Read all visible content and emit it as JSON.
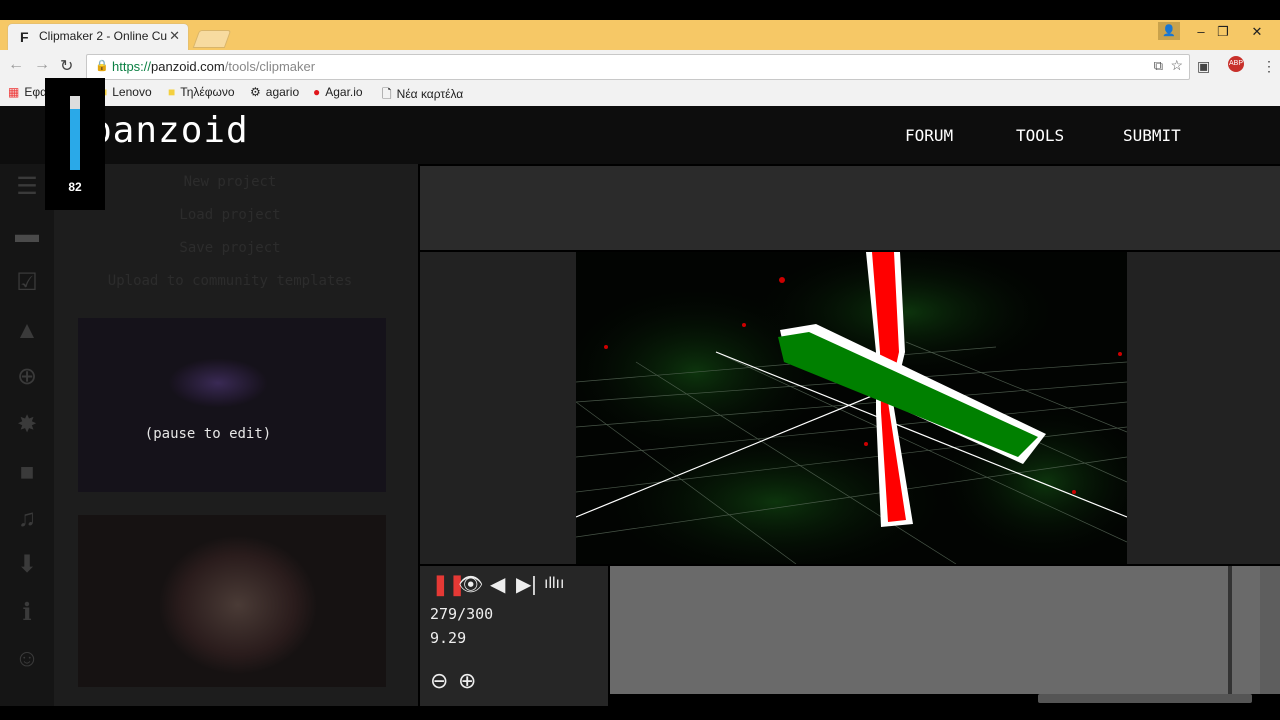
{
  "browser": {
    "tab_title": "Clipmaker 2 - Online Cu",
    "tab_favicon": "F",
    "url_scheme": "https://",
    "url_host": "panzoid.com",
    "url_path": "/tools/clipmaker",
    "bookmarks": [
      {
        "label": "Εφα",
        "icon": "apps-icon"
      },
      {
        "label": "Lenovo",
        "icon": "folder-icon"
      },
      {
        "label": "Τηλέφωνο",
        "icon": "folder-icon"
      },
      {
        "label": "agario",
        "icon": "gear-icon"
      },
      {
        "label": "Agar.io",
        "icon": "red-circle-icon"
      },
      {
        "label": "Νέα καρτέλα",
        "icon": "page-icon"
      }
    ]
  },
  "site": {
    "logo": "panzoid",
    "nav": [
      "FORUM",
      "TOOLS",
      "SUBMIT"
    ]
  },
  "sidebar": {
    "menu": [
      "New project",
      "Load project",
      "Save project",
      "Upload to community templates"
    ],
    "pause_label": "(pause to edit)",
    "icons": [
      "menu-icon",
      "folder-icon",
      "edit-icon",
      "image-icon",
      "globe-icon",
      "burst-icon",
      "camera-icon",
      "music-icon",
      "download-icon",
      "info-icon",
      "smiley-icon"
    ]
  },
  "player": {
    "frame": "279/300",
    "time": "9.29",
    "controls": [
      "pause-icon",
      "eye-icon",
      "volume-icon",
      "step-icon",
      "waveform-icon"
    ]
  },
  "meter": {
    "value": "82",
    "level": 0.82
  },
  "colors": {
    "accent_blue": "#2aa9e8",
    "bar_red": "#ff0000",
    "bar_green": "#008000"
  }
}
